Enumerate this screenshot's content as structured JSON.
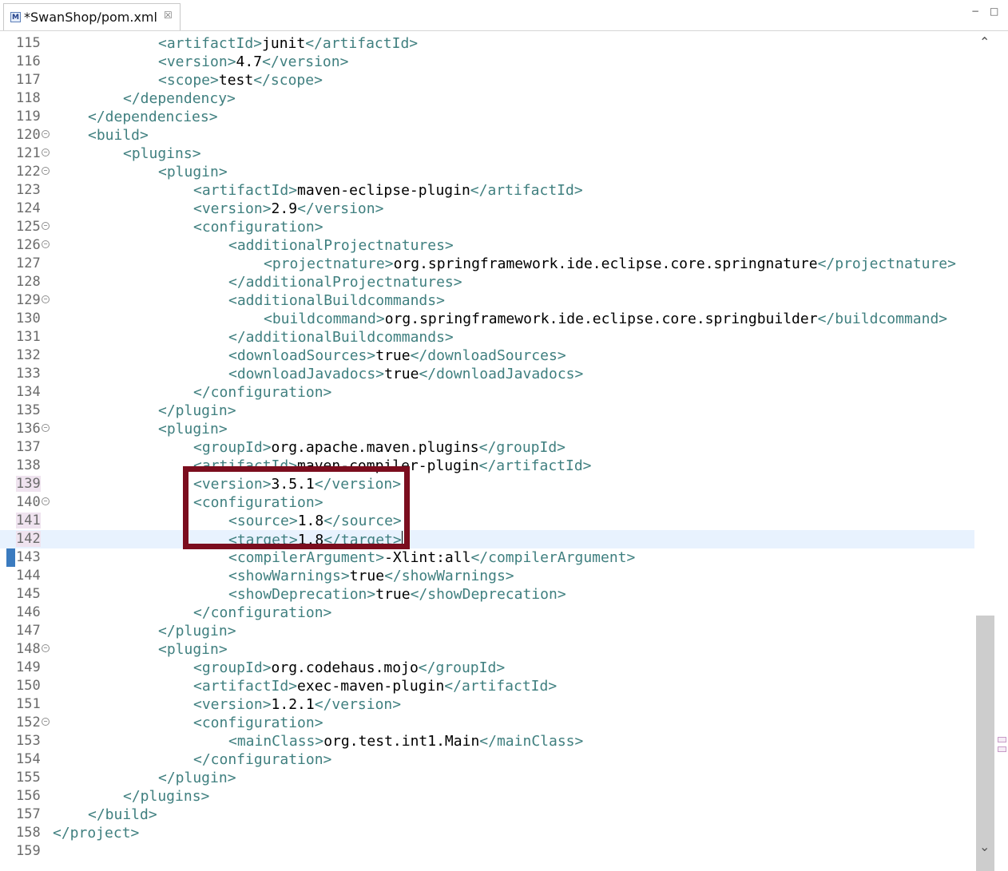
{
  "tab": {
    "title": "*SwanShop/pom.xml",
    "icon_letter": "M",
    "close_glyph": "☒"
  },
  "window": {
    "minimize_glyph": "−",
    "maximize_glyph": "□"
  },
  "colors": {
    "tag": "#3f7f7f",
    "highlight_box": "#7b0d1e",
    "current_line": "#e8f2fe"
  },
  "lines": [
    {
      "n": "115",
      "indent": 3,
      "open": "<artifactId>",
      "text": "junit",
      "close": "</artifactId>"
    },
    {
      "n": "116",
      "indent": 3,
      "open": "<version>",
      "text": "4.7",
      "close": "</version>"
    },
    {
      "n": "117",
      "indent": 3,
      "open": "<scope>",
      "text": "test",
      "close": "</scope>"
    },
    {
      "n": "118",
      "indent": 2,
      "open": "</dependency>"
    },
    {
      "n": "119",
      "indent": 1,
      "open": "</dependencies>"
    },
    {
      "n": "120",
      "indent": 1,
      "open": "<build>",
      "fold": true
    },
    {
      "n": "121",
      "indent": 2,
      "open": "<plugins>",
      "fold": true
    },
    {
      "n": "122",
      "indent": 3,
      "open": "<plugin>",
      "fold": true
    },
    {
      "n": "123",
      "indent": 4,
      "open": "<artifactId>",
      "text": "maven-eclipse-plugin",
      "close": "</artifactId>"
    },
    {
      "n": "124",
      "indent": 4,
      "open": "<version>",
      "text": "2.9",
      "close": "</version>"
    },
    {
      "n": "125",
      "indent": 4,
      "open": "<configuration>",
      "fold": true
    },
    {
      "n": "126",
      "indent": 5,
      "open": "<additionalProjectnatures>",
      "fold": true
    },
    {
      "n": "127",
      "indent": 6,
      "open": "<projectnature>",
      "text": "org.springframework.ide.eclipse.core.springnature",
      "close": "</projectnature>"
    },
    {
      "n": "128",
      "indent": 5,
      "open": "</additionalProjectnatures>"
    },
    {
      "n": "129",
      "indent": 5,
      "open": "<additionalBuildcommands>",
      "fold": true
    },
    {
      "n": "130",
      "indent": 6,
      "open": "<buildcommand>",
      "text": "org.springframework.ide.eclipse.core.springbuilder",
      "close": "</buildcommand>"
    },
    {
      "n": "131",
      "indent": 5,
      "open": "</additionalBuildcommands>"
    },
    {
      "n": "132",
      "indent": 5,
      "open": "<downloadSources>",
      "text": "true",
      "close": "</downloadSources>"
    },
    {
      "n": "133",
      "indent": 5,
      "open": "<downloadJavadocs>",
      "text": "true",
      "close": "</downloadJavadocs>"
    },
    {
      "n": "134",
      "indent": 4,
      "open": "</configuration>"
    },
    {
      "n": "135",
      "indent": 3,
      "open": "</plugin>"
    },
    {
      "n": "136",
      "indent": 3,
      "open": "<plugin>",
      "fold": true
    },
    {
      "n": "137",
      "indent": 4,
      "open": "<groupId>",
      "text": "org.apache.maven.plugins",
      "close": "</groupId>"
    },
    {
      "n": "138",
      "indent": 4,
      "open": "<artifactId>",
      "text": "maven-compiler-plugin",
      "close": "</artifactId>"
    },
    {
      "n": "139",
      "indent": 4,
      "open": "<version>",
      "text": "3.5.1",
      "close": "</version>",
      "changed": true
    },
    {
      "n": "140",
      "indent": 4,
      "open": "<configuration>",
      "fold": true
    },
    {
      "n": "141",
      "indent": 5,
      "open": "<source>",
      "text": "1.8",
      "close": "</source>",
      "changed": true
    },
    {
      "n": "142",
      "indent": 5,
      "open": "<target>",
      "text": "1.8",
      "close": "</target>",
      "changed": true,
      "current": true
    },
    {
      "n": "143",
      "indent": 5,
      "open": "<compilerArgument>",
      "text": "-Xlint:all",
      "close": "</compilerArgument>"
    },
    {
      "n": "144",
      "indent": 5,
      "open": "<showWarnings>",
      "text": "true",
      "close": "</showWarnings>"
    },
    {
      "n": "145",
      "indent": 5,
      "open": "<showDeprecation>",
      "text": "true",
      "close": "</showDeprecation>"
    },
    {
      "n": "146",
      "indent": 4,
      "open": "</configuration>"
    },
    {
      "n": "147",
      "indent": 3,
      "open": "</plugin>"
    },
    {
      "n": "148",
      "indent": 3,
      "open": "<plugin>",
      "fold": true
    },
    {
      "n": "149",
      "indent": 4,
      "open": "<groupId>",
      "text": "org.codehaus.mojo",
      "close": "</groupId>"
    },
    {
      "n": "150",
      "indent": 4,
      "open": "<artifactId>",
      "text": "exec-maven-plugin",
      "close": "</artifactId>"
    },
    {
      "n": "151",
      "indent": 4,
      "open": "<version>",
      "text": "1.2.1",
      "close": "</version>"
    },
    {
      "n": "152",
      "indent": 4,
      "open": "<configuration>",
      "fold": true
    },
    {
      "n": "153",
      "indent": 5,
      "open": "<mainClass>",
      "text": "org.test.int1.Main",
      "close": "</mainClass>"
    },
    {
      "n": "154",
      "indent": 4,
      "open": "</configuration>"
    },
    {
      "n": "155",
      "indent": 3,
      "open": "</plugin>"
    },
    {
      "n": "156",
      "indent": 2,
      "open": "</plugins>"
    },
    {
      "n": "157",
      "indent": 1,
      "open": "</build>"
    },
    {
      "n": "158",
      "indent": 0,
      "open": "</project>"
    },
    {
      "n": "159",
      "indent": 0
    }
  ]
}
